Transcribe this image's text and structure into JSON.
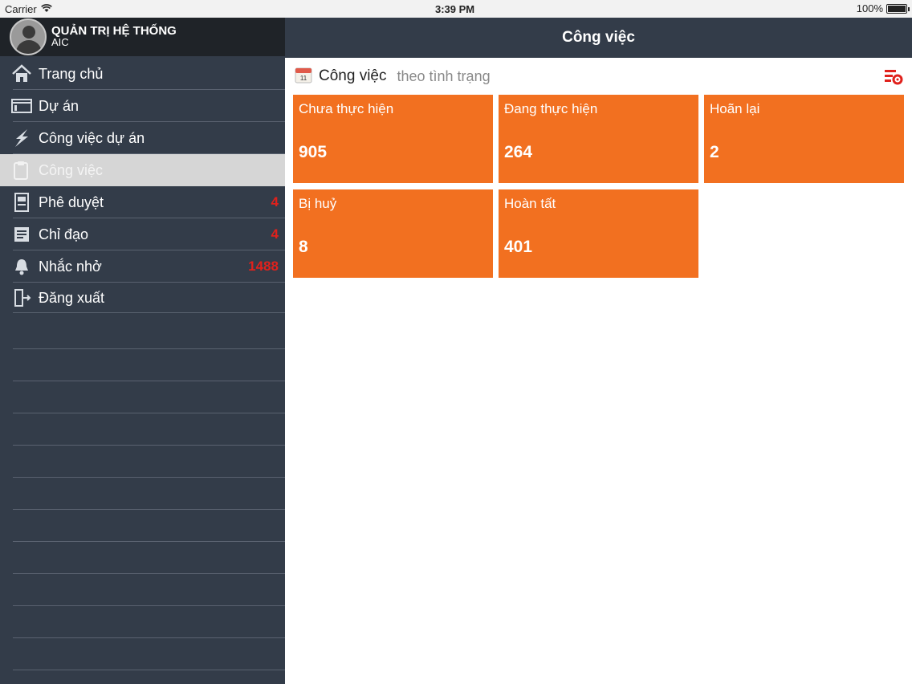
{
  "status_bar": {
    "carrier": "Carrier",
    "time": "3:39 PM",
    "battery": "100%"
  },
  "profile": {
    "name": "QUẢN TRỊ HỆ THỐNG",
    "organization": "AIC"
  },
  "menu": [
    {
      "label": "Trang chủ",
      "icon": "home-icon",
      "badge": ""
    },
    {
      "label": "Dự án",
      "icon": "window-icon",
      "badge": ""
    },
    {
      "label": "Công việc dự án",
      "icon": "lightning-icon",
      "badge": ""
    },
    {
      "label": "Công việc",
      "icon": "clipboard-icon",
      "badge": "",
      "active": true
    },
    {
      "label": "Phê duyệt",
      "icon": "document-icon",
      "badge": "4"
    },
    {
      "label": "Chỉ đạo",
      "icon": "list-icon",
      "badge": "4"
    },
    {
      "label": "Nhắc nhở",
      "icon": "bell-icon",
      "badge": "1488"
    },
    {
      "label": "Đăng xuất",
      "icon": "logout-icon",
      "badge": ""
    }
  ],
  "navbar": {
    "title": "Công việc"
  },
  "section": {
    "title": "Công việc",
    "subtitle": "theo tình trạng",
    "icon": "calendar-icon",
    "action_icon": "settings-icon"
  },
  "tiles": [
    {
      "label": "Chưa thực hiện",
      "value": "905"
    },
    {
      "label": "Đang thực hiện",
      "value": "264"
    },
    {
      "label": "Hoãn lại",
      "value": "2"
    },
    {
      "label": "Bị huỷ",
      "value": "8"
    },
    {
      "label": "Hoàn tất",
      "value": "401"
    }
  ],
  "colors": {
    "sidebar": "#333c49",
    "tile": "#f27020",
    "badge": "#e0211c",
    "navbar": "#333c49"
  }
}
